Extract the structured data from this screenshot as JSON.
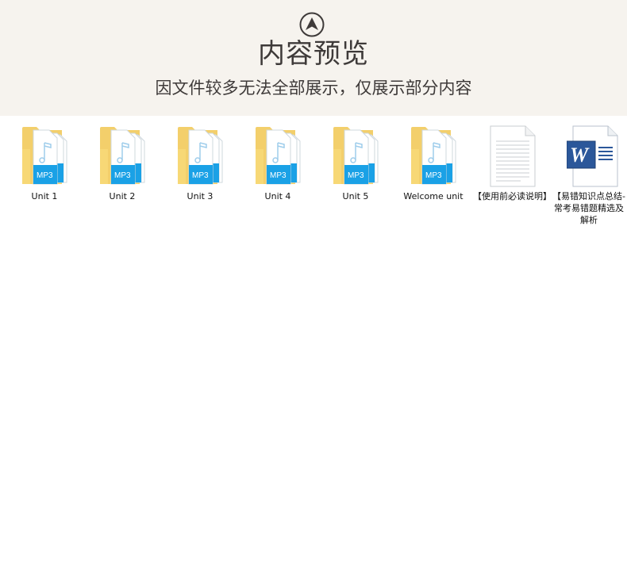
{
  "header": {
    "icon": "up-arrow-circle-icon",
    "title": "内容预览",
    "subtitle": "因文件较多无法全部展示，仅展示部分内容",
    "background": "#f6f3ee",
    "text_color": "#3e3a39"
  },
  "files": [
    {
      "type": "folder",
      "icon": "mp3-folder-icon",
      "label": "Unit 1"
    },
    {
      "type": "folder",
      "icon": "mp3-folder-icon",
      "label": "Unit 2"
    },
    {
      "type": "folder",
      "icon": "mp3-folder-icon",
      "label": "Unit 3"
    },
    {
      "type": "folder",
      "icon": "mp3-folder-icon",
      "label": "Unit 4"
    },
    {
      "type": "folder",
      "icon": "mp3-folder-icon",
      "label": "Unit 5"
    },
    {
      "type": "folder",
      "icon": "mp3-folder-icon",
      "label": "Welcome unit"
    },
    {
      "type": "text",
      "icon": "text-document-icon",
      "label": "【使用前必读说明】"
    },
    {
      "type": "word",
      "icon": "word-document-icon",
      "label": "【易错知识点总结-常考易错题精选及解析"
    }
  ]
}
